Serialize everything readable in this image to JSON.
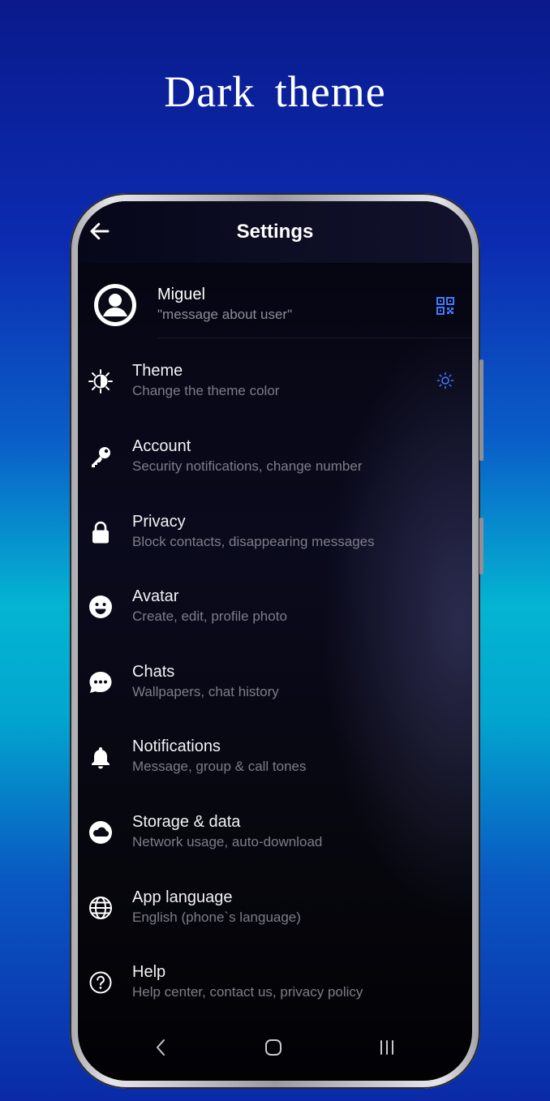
{
  "headline": "Dark theme",
  "appbar": {
    "title": "Settings",
    "back_icon": "arrow-left-icon"
  },
  "profile": {
    "name": "Miguel",
    "status": "\"message about user\"",
    "qr_icon": "qr-code-icon"
  },
  "menu": [
    {
      "key": "theme",
      "title": "Theme",
      "subtitle": "Change the theme color",
      "icon": "contrast-sun-icon"
    },
    {
      "key": "account",
      "title": "Account",
      "subtitle": "Security notifications, change number",
      "icon": "key-icon"
    },
    {
      "key": "privacy",
      "title": "Privacy",
      "subtitle": "Block contacts, disappearing messages",
      "icon": "lock-icon"
    },
    {
      "key": "avatar",
      "title": "Avatar",
      "subtitle": "Create, edit, profile photo",
      "icon": "smiley-icon"
    },
    {
      "key": "chats",
      "title": "Chats",
      "subtitle": "Wallpapers, chat history",
      "icon": "chat-bubble-icon"
    },
    {
      "key": "notifications",
      "title": "Notifications",
      "subtitle": "Message, group & call tones",
      "icon": "bell-icon"
    },
    {
      "key": "storage",
      "title": "Storage & data",
      "subtitle": "Network usage, auto-download",
      "icon": "cloud-icon"
    },
    {
      "key": "language",
      "title": "App language",
      "subtitle": "English (phone`s language)",
      "icon": "globe-icon"
    },
    {
      "key": "help",
      "title": "Help",
      "subtitle": "Help center, contact us, privacy policy",
      "icon": "help-circle-icon"
    }
  ],
  "navbar": {
    "back": "nav-back-icon",
    "home": "nav-home-icon",
    "recents": "nav-recents-icon"
  },
  "colors": {
    "accent": "#3f7bff",
    "text": "#f2f2f5",
    "subtext": "#7d7d89"
  }
}
